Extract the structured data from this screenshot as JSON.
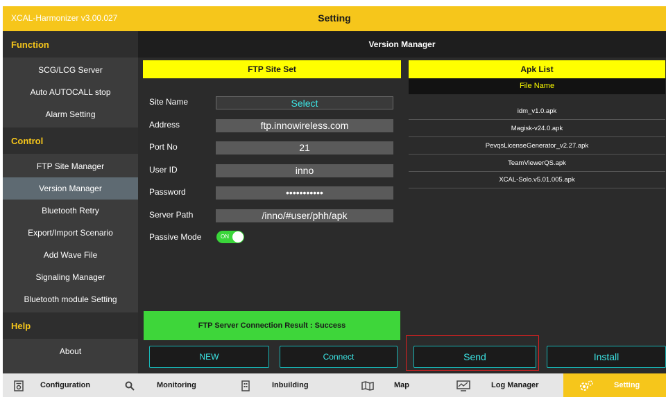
{
  "app": {
    "name": "XCAL-Harmonizer v3.00.027",
    "title": "Setting"
  },
  "sidebar": {
    "function_header": "Function",
    "function_items": [
      "SCG/LCG Server",
      "Auto AUTOCALL stop",
      "Alarm Setting"
    ],
    "control_header": "Control",
    "control_items": [
      "FTP Site Manager",
      "Version Manager",
      "Bluetooth Retry",
      "Export/Import Scenario",
      "Add Wave File",
      "Signaling Manager",
      "Bluetooth module Setting"
    ],
    "active_item": "Version Manager",
    "help_header": "Help",
    "help_items": [
      "About"
    ]
  },
  "main": {
    "header": "Version Manager"
  },
  "ftp": {
    "header": "FTP Site Set",
    "site_name_label": "Site Name",
    "site_name_value": "Select",
    "address_label": "Address",
    "address_value": "ftp.innowireless.com",
    "port_label": "Port No",
    "port_value": "21",
    "user_label": "User ID",
    "user_value": "inno",
    "password_label": "Password",
    "password_value": "•••••••••••",
    "path_label": "Server Path",
    "path_value": "/inno/#user/phh/apk",
    "passive_label": "Passive Mode",
    "passive_toggle_text": "ON",
    "passive_on": true,
    "result": "FTP Server Connection Result : Success",
    "new_button": "NEW",
    "connect_button": "Connect"
  },
  "apk": {
    "header": "Apk List",
    "column": "File Name",
    "files": [
      "idm_v1.0.apk",
      "Magisk-v24.0.apk",
      "PevqsLicenseGenerator_v2.27.apk",
      "TeamViewerQS.apk",
      "XCAL-Solo.v5.01.005.apk"
    ],
    "send_button": "Send",
    "install_button": "Install"
  },
  "bottom": {
    "configuration": "Configuration",
    "monitoring": "Monitoring",
    "inbuilding": "Inbuilding",
    "map": "Map",
    "log_manager": "Log Manager",
    "setting": "Setting"
  },
  "colors": {
    "accent": "#f6c61b",
    "highlight": "#ffff00",
    "success": "#3ed63a",
    "button_text": "#3ce6e6",
    "selection_box": "#e02020"
  },
  "icons": [
    "configuration-icon",
    "search-icon",
    "building-icon",
    "map-icon",
    "log-manager-icon",
    "settings-gear-icon"
  ]
}
